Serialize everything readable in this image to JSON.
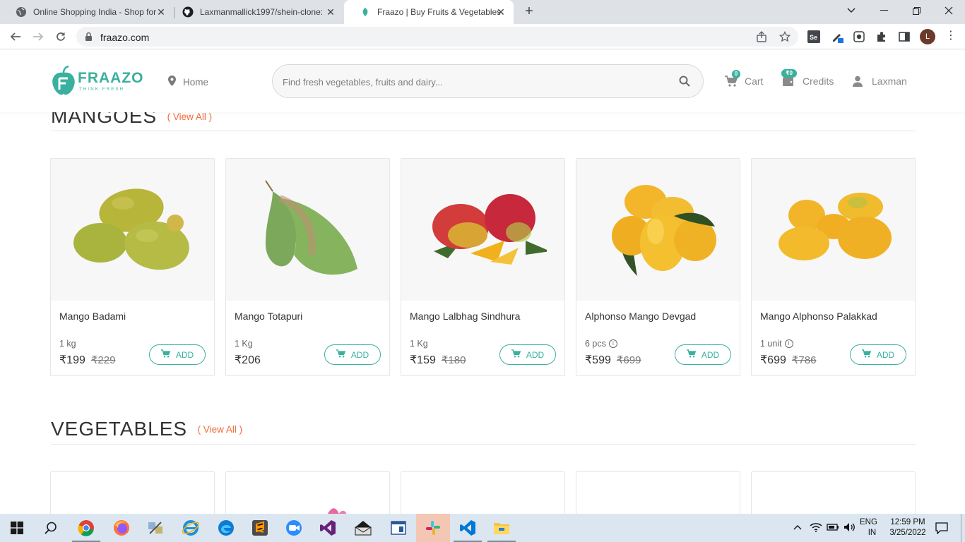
{
  "browser": {
    "tabs": [
      {
        "title": "Online Shopping India - Shop for",
        "icon": "globe-icon",
        "active": false
      },
      {
        "title": "Laxmanmallick1997/shein-clone:",
        "icon": "github-icon",
        "active": false
      },
      {
        "title": "Fraazo | Buy Fruits & Vegetables",
        "icon": "fraazo-leaf-icon",
        "active": true
      }
    ],
    "url": "fraazo.com",
    "profile_initial": "L"
  },
  "header": {
    "logo_text": "FRAAZO",
    "logo_tagline": "THINK FRESH",
    "home_label": "Home",
    "search_placeholder": "Find fresh vegetables, fruits and dairy...",
    "cart_label": "Cart",
    "cart_count": "0",
    "credits_label": "Credits",
    "credits_badge": "₹0",
    "user_label": "Laxman"
  },
  "sections": {
    "mangoes": {
      "title": "MANGOES",
      "view_all": "( View All )",
      "products": [
        {
          "name": "Mango Badami",
          "qty": "1 kg",
          "info": false,
          "price": "₹199",
          "mrp": "₹229",
          "add": "ADD"
        },
        {
          "name": "Mango Totapuri",
          "qty": "1 Kg",
          "info": false,
          "price": "₹206",
          "mrp": "",
          "add": "ADD"
        },
        {
          "name": "Mango Lalbhag Sindhura",
          "qty": "1 Kg",
          "info": false,
          "price": "₹159",
          "mrp": "₹180",
          "add": "ADD"
        },
        {
          "name": "Alphonso Mango Devgad",
          "qty": "6 pcs",
          "info": true,
          "price": "₹599",
          "mrp": "₹699",
          "add": "ADD"
        },
        {
          "name": "Mango Alphonso Palakkad",
          "qty": "1 unit",
          "info": true,
          "price": "₹699",
          "mrp": "₹786",
          "add": "ADD"
        }
      ]
    },
    "vegetables": {
      "title": "VEGETABLES",
      "view_all": "( View All )"
    }
  },
  "taskbar": {
    "language": "ENG",
    "region": "IN",
    "time": "12:59 PM",
    "date": "3/25/2022"
  },
  "colors": {
    "brand": "#3ab09e",
    "accent": "#f26b3a"
  }
}
